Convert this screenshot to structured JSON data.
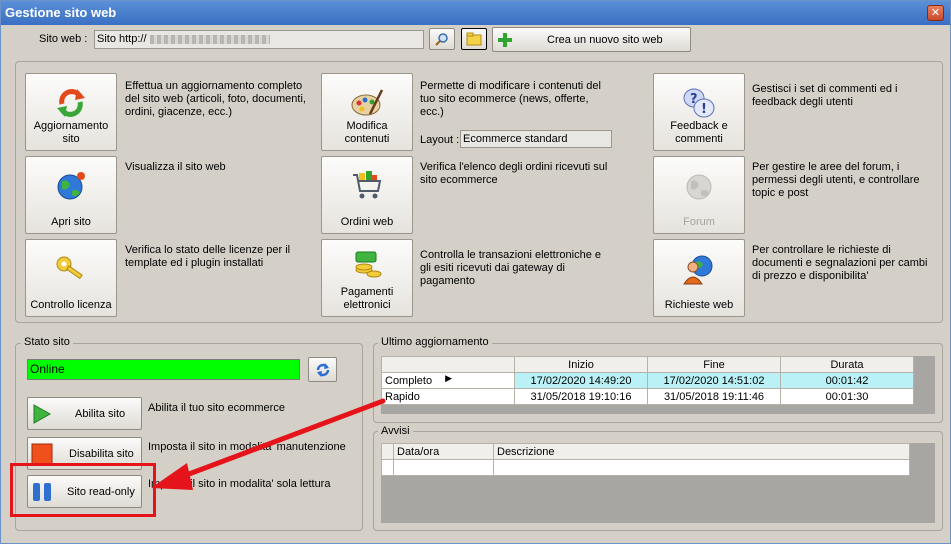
{
  "window": {
    "title": "Gestione sito web",
    "close_glyph": "✕"
  },
  "header": {
    "site_label": "Sito web :",
    "site_value": "Sito http://",
    "create_label": "Crea un nuovo sito web"
  },
  "tiles": {
    "aggiornamento": {
      "label": "Aggiornamento sito",
      "desc": "Effettua un aggiornamento completo del sito web (articoli, foto, documenti, ordini, giacenze, ecc.)"
    },
    "modifica": {
      "label": "Modifica contenuti",
      "desc": "Permette di modificare i contenuti del tuo sito ecommerce (news, offerte, ecc.)",
      "layout_label": "Layout :",
      "layout_value": "Ecommerce standard"
    },
    "feedback": {
      "label": "Feedback e commenti",
      "desc": "Gestisci i set di commenti ed i feedback degli utenti"
    },
    "apri": {
      "label": "Apri sito",
      "desc": "Visualizza il sito web"
    },
    "ordini": {
      "label": "Ordini web",
      "desc": "Verifica l'elenco degli ordini ricevuti sul sito ecommerce"
    },
    "forum": {
      "label": "Forum",
      "desc": "Per gestire le aree del forum, i permessi degli utenti, e controllare topic e post"
    },
    "licenza": {
      "label": "Controllo licenza",
      "desc": "Verifica lo stato delle licenze per il template ed i plugin installati"
    },
    "pagamenti": {
      "label": "Pagamenti elettronici",
      "desc": "Controlla le transazioni elettroniche e gli esiti ricevuti dai gateway di pagamento"
    },
    "richieste": {
      "label": "Richieste web",
      "desc": "Per controllare le richieste di documenti e segnalazioni per cambi di prezzo e disponibilita'"
    }
  },
  "stato": {
    "title": "Stato sito",
    "status": "Online",
    "status_color": "#00ff00",
    "abilita": {
      "label": "Abilita sito",
      "desc": "Abilita il tuo sito ecommerce"
    },
    "disabilita": {
      "label": "Disabilita sito",
      "desc": "Imposta il sito in modalita' manutenzione"
    },
    "readonly": {
      "label": "Sito read-only",
      "desc": "Imposta il sito in modalita' sola lettura"
    }
  },
  "ultimo": {
    "title": "Ultimo aggiornamento",
    "headers": [
      "",
      "Inizio",
      "Fine",
      "Durata"
    ],
    "rows": [
      {
        "name": "Completo",
        "inizio": "17/02/2020 14:49:20",
        "fine": "17/02/2020 14:51:02",
        "durata": "00:01:42"
      },
      {
        "name": "Rapido",
        "inizio": "31/05/2018 19:10:16",
        "fine": "31/05/2018 19:11:46",
        "durata": "00:01:30"
      }
    ]
  },
  "avvisi": {
    "title": "Avvisi",
    "headers": [
      "Data/ora",
      "Descrizione"
    ]
  },
  "colors": {
    "highlight": "#e5141b",
    "selected_cell": "#b9f1f6"
  }
}
